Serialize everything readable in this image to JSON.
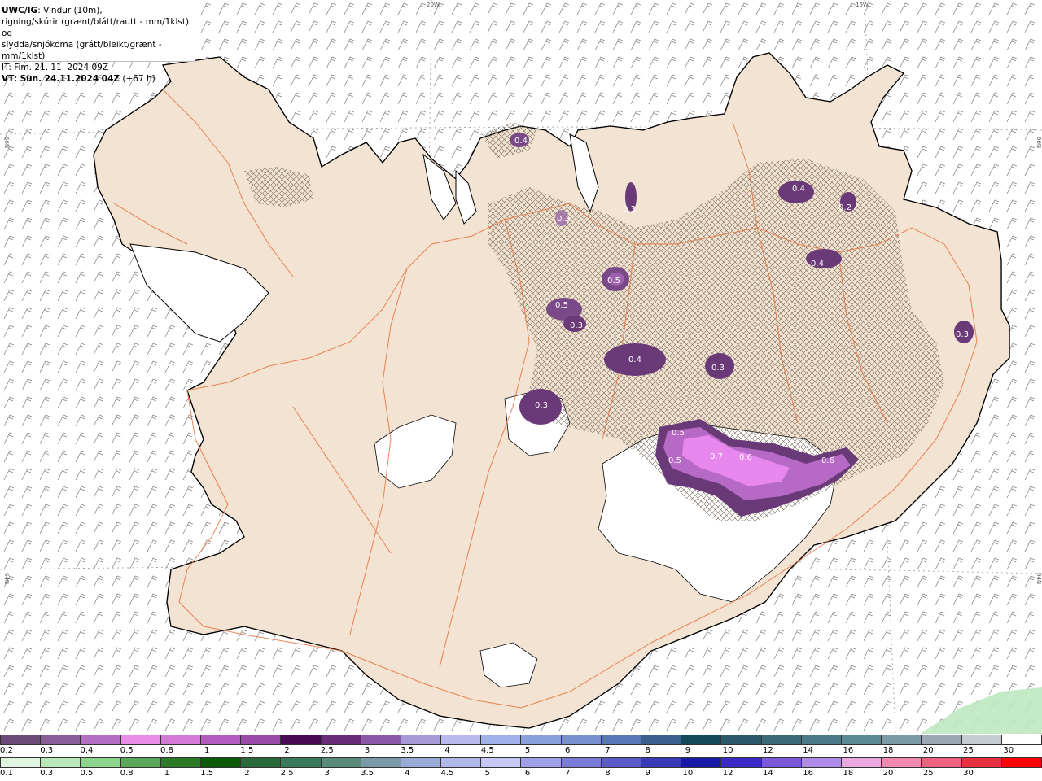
{
  "header": {
    "title": "UWC/IG",
    "title_rest": ": Vindur (10m),",
    "line2": "rigning/skúrir (grænt/blátt/rautt - mm/1klst) og",
    "line3": "slydda/snjókoma (grátt/bleikt/grænt - mm/1klst)",
    "line4": "IT: Fim. 21. 11. 2024 09Z",
    "line5_bold": "VT: Sun. 24.11.2024 04Z",
    "line5_rest": " (+67 h)"
  },
  "axis_labels": {
    "lon_20w": "20W",
    "lon_15w": "15W",
    "lat_66n_left": "66N",
    "lat_66n_right": "66N",
    "lat_64n_left": "64N",
    "lat_64n_right": "64N"
  },
  "contour_labels": [
    "0.4",
    "0.3",
    "0.3",
    "0.4",
    "0.2",
    "0.1",
    "0.4",
    "0.5",
    "0.5",
    "0.3",
    "0.4",
    "0.3",
    "0.3",
    "0.3",
    "0.5",
    "0.5",
    "0.7",
    "0.6",
    "0.6"
  ],
  "legend_top": {
    "labels": [
      "0.2",
      "0.3",
      "0.4",
      "0.5",
      "0.8",
      "1",
      "1.5",
      "2",
      "2.5",
      "3",
      "3.5",
      "4",
      "4.5",
      "5",
      "6",
      "7",
      "8",
      "9",
      "10",
      "12",
      "14",
      "16",
      "18",
      "20",
      "25",
      "30"
    ],
    "colors": [
      "#6b4a78",
      "#8a5e98",
      "#b46ec4",
      "#e98ce8",
      "#d27ad6",
      "#b55cc0",
      "#9a4aa8",
      "#4a0a55",
      "#6a2b78",
      "#8a5aa8",
      "#a89ad8",
      "#b9b9f0",
      "#a0b0e8",
      "#8aa0dc",
      "#7890d0",
      "#5878b8",
      "#3a6090",
      "#144a5a",
      "#2a5a6a",
      "#3a6a78",
      "#4a7a88",
      "#5a8a96",
      "#7a9aa6",
      "#9aa8b2",
      "#c6ccd0",
      "#ffffff"
    ]
  },
  "legend_bottom": {
    "labels": [
      "0.1",
      "0.3",
      "0.5",
      "0.8",
      "1",
      "1.5",
      "2",
      "2.5",
      "3",
      "3.5",
      "4",
      "4.5",
      "5",
      "6",
      "7",
      "8",
      "9",
      "10",
      "12",
      "14",
      "16",
      "18",
      "20",
      "25",
      "30"
    ],
    "colors": [
      "#e0f5e0",
      "#b8e8b8",
      "#8cd48c",
      "#5aa85a",
      "#2a7a2a",
      "#0a5a0a",
      "#2a6a3a",
      "#3a7a5a",
      "#5a8a7a",
      "#7a9aa8",
      "#9aaad8",
      "#b0b8ea",
      "#c8c8f8",
      "#a0a0e8",
      "#7a7ad8",
      "#5a5ac8",
      "#3a3ab8",
      "#1a1aa8",
      "#3a2ac8",
      "#7a5ad8",
      "#b08ae8",
      "#e8a8e0",
      "#f088b0",
      "#f06080",
      "#e83040",
      "#ff0000"
    ]
  }
}
